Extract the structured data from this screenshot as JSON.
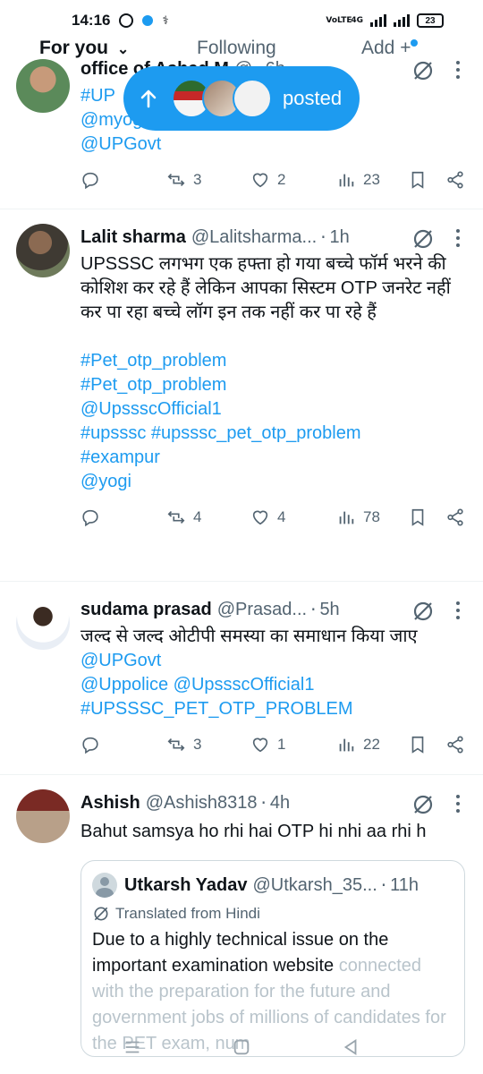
{
  "status_bar": {
    "time": "14:16",
    "network_label": "VoLTE",
    "signal_label": "4G",
    "battery": "23"
  },
  "tabs": {
    "for_you": "For you",
    "following": "Following",
    "add": "Add +"
  },
  "posted_pill": {
    "label": "posted"
  },
  "tweets": [
    {
      "name": "office of Ashad M",
      "handle": "@",
      "time": "6h",
      "body_lines": [
        "#UP",
        "@myog...Official1",
        "@UPGovt"
      ],
      "replies": "",
      "reposts": "3",
      "likes": "2",
      "views": "23"
    },
    {
      "name": "Lalit sharma",
      "handle": "@Lalitsharma...",
      "time": "1h",
      "text": "UPSSSC लगभग एक हफ्ता हो गया बच्चे फॉर्म भरने की कोशिश कर रहे हैं लेकिन आपका सिस्टम OTP जनरेट नहीं कर पा रहा बच्चे लॉग इन तक नहीं कर पा रहे हैं",
      "links": [
        " #Pet_otp_problem",
        "#Pet_otp_problem",
        "@UpssscOfficial1",
        " #upsssc #upsssc_pet_otp_problem",
        "#exampur",
        "@yogi"
      ],
      "reposts": "4",
      "likes": "4",
      "views": "78"
    },
    {
      "name": "sudama prasad",
      "handle": "@Prasad...",
      "time": "5h",
      "text": "जल्द से जल्द ओटीपी समस्या का समाधान किया जाए",
      "links": [
        "@UPGovt",
        "@Uppolice @UpssscOfficial1",
        "#UPSSSC_PET_OTP_PROBLEM"
      ],
      "reposts": "3",
      "likes": "1",
      "views": "22"
    },
    {
      "name": "Ashish",
      "handle": "@Ashish8318",
      "time": "4h",
      "text": "Bahut samsya ho rhi hai OTP hi nhi aa rhi h",
      "quote": {
        "name": "Utkarsh Yadav",
        "handle": "@Utkarsh_35...",
        "time": "11h",
        "translated": "Translated from Hindi",
        "text": "Due to a highly technical issue on the important examination website",
        "faded_text": "connected with the preparation for the future and government jobs of millions of candidates for the PET exam, num"
      }
    }
  ],
  "colors": {
    "accent": "#1d9bf0",
    "text": "#0f1419",
    "muted": "#536471",
    "border": "#eff3f4"
  }
}
